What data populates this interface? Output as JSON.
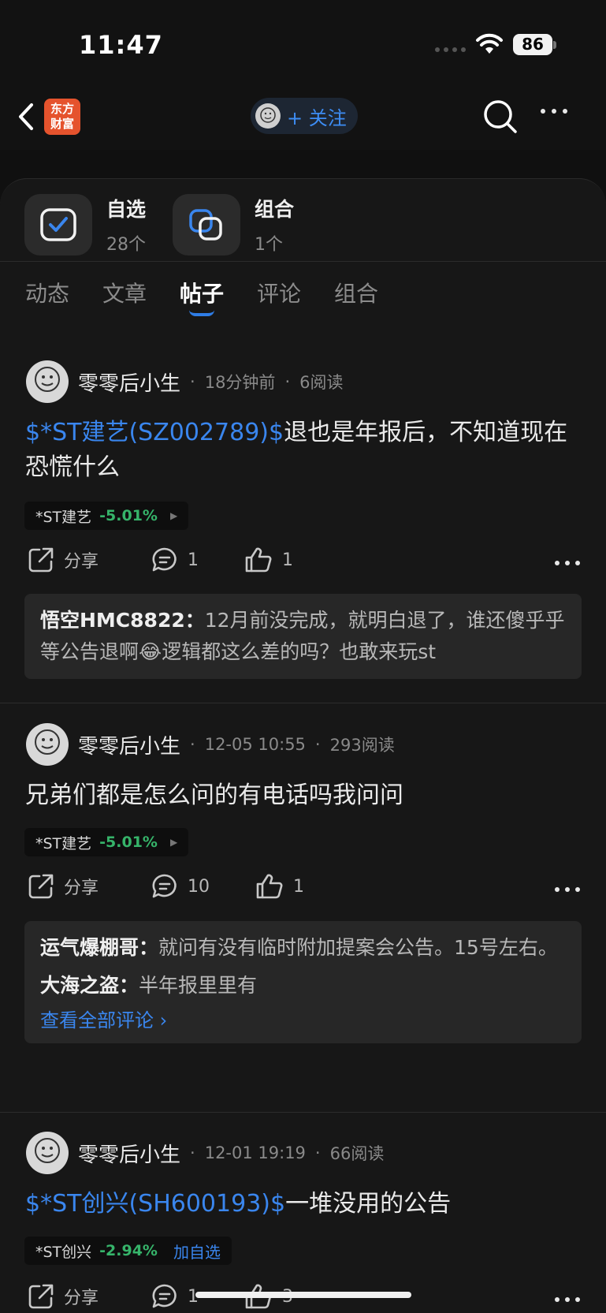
{
  "status_bar": {
    "time": "11:47",
    "battery": "86"
  },
  "nav": {
    "logo_line1": "东方",
    "logo_line2": "财富",
    "follow_label": "+ 关注"
  },
  "shortcuts": [
    {
      "title": "自选",
      "count": "28个"
    },
    {
      "title": "组合",
      "count": "1个"
    }
  ],
  "tabs": [
    "动态",
    "文章",
    "帖子",
    "评论",
    "组合"
  ],
  "active_tab": "帖子",
  "posts": [
    {
      "author": "零零后小生",
      "time": "18分钟前",
      "reads": "6阅读",
      "stock_link": "$*ST建艺(SZ002789)$",
      "text": "退也是年报后，不知道现在恐慌什么",
      "chip_name": "*ST建艺",
      "chip_pct": "-5.01%",
      "share": "分享",
      "comments_count": "1",
      "likes": "1",
      "comments": [
        {
          "name": "悟空HMC8822：",
          "text": "12月前没完成，就明白退了，谁还傻乎乎等公告退啊😂逻辑都这么差的吗？也敢来玩st"
        }
      ]
    },
    {
      "author": "零零后小生",
      "time": "12-05 10:55",
      "reads": "293阅读",
      "text": "兄弟们都是怎么问的有电话吗我问问",
      "chip_name": "*ST建艺",
      "chip_pct": "-5.01%",
      "share": "分享",
      "comments_count": "10",
      "likes": "1",
      "comments": [
        {
          "name": "运气爆棚哥：",
          "text": "就问有没有临时附加提案会公告。15号左右。"
        },
        {
          "name": "大海之盗：",
          "text": "半年报里里有"
        }
      ],
      "view_all": "查看全部评论 ›"
    },
    {
      "author": "零零后小生",
      "time": "12-01 19:19",
      "reads": "66阅读",
      "stock_link": "$*ST创兴(SH600193)$",
      "text": "一堆没用的公告",
      "chip_name": "*ST创兴",
      "chip_pct": "-2.94%",
      "chip_action": "加自选",
      "share": "分享",
      "comments_count": "1",
      "likes": "3"
    }
  ],
  "colors": {
    "accent": "#3a86ee",
    "down_green": "#36b46a",
    "background": "#171717",
    "logo": "#e5532d"
  },
  "icons": [
    "back-icon",
    "search-icon",
    "more-icon",
    "watchlist-icon",
    "portfolio-icon",
    "share-icon",
    "comment-icon",
    "like-icon",
    "wifi-icon"
  ]
}
